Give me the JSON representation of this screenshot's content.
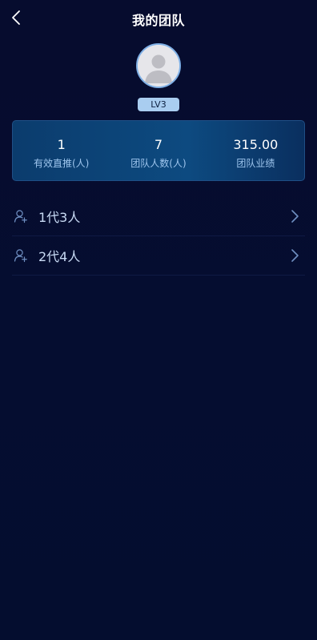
{
  "header": {
    "title": "我的团队",
    "back_icon": "chevron-left-icon"
  },
  "profile": {
    "avatar_icon": "user-avatar-icon",
    "level": "LV3"
  },
  "stats": [
    {
      "value": "1",
      "label": "有效直推(人)"
    },
    {
      "value": "7",
      "label": "团队人数(人)"
    },
    {
      "value": "315.00",
      "label": "团队业绩"
    }
  ],
  "generations": [
    {
      "label": "1代3人",
      "icon": "add-user-icon",
      "chevron": "chevron-right-icon"
    },
    {
      "label": "2代4人",
      "icon": "add-user-icon",
      "chevron": "chevron-right-icon"
    }
  ],
  "colors": {
    "background": "#040c2c",
    "card": "#0d4a80",
    "accent_text": "#9fc6ee",
    "level_badge": "#a9cdf0"
  }
}
